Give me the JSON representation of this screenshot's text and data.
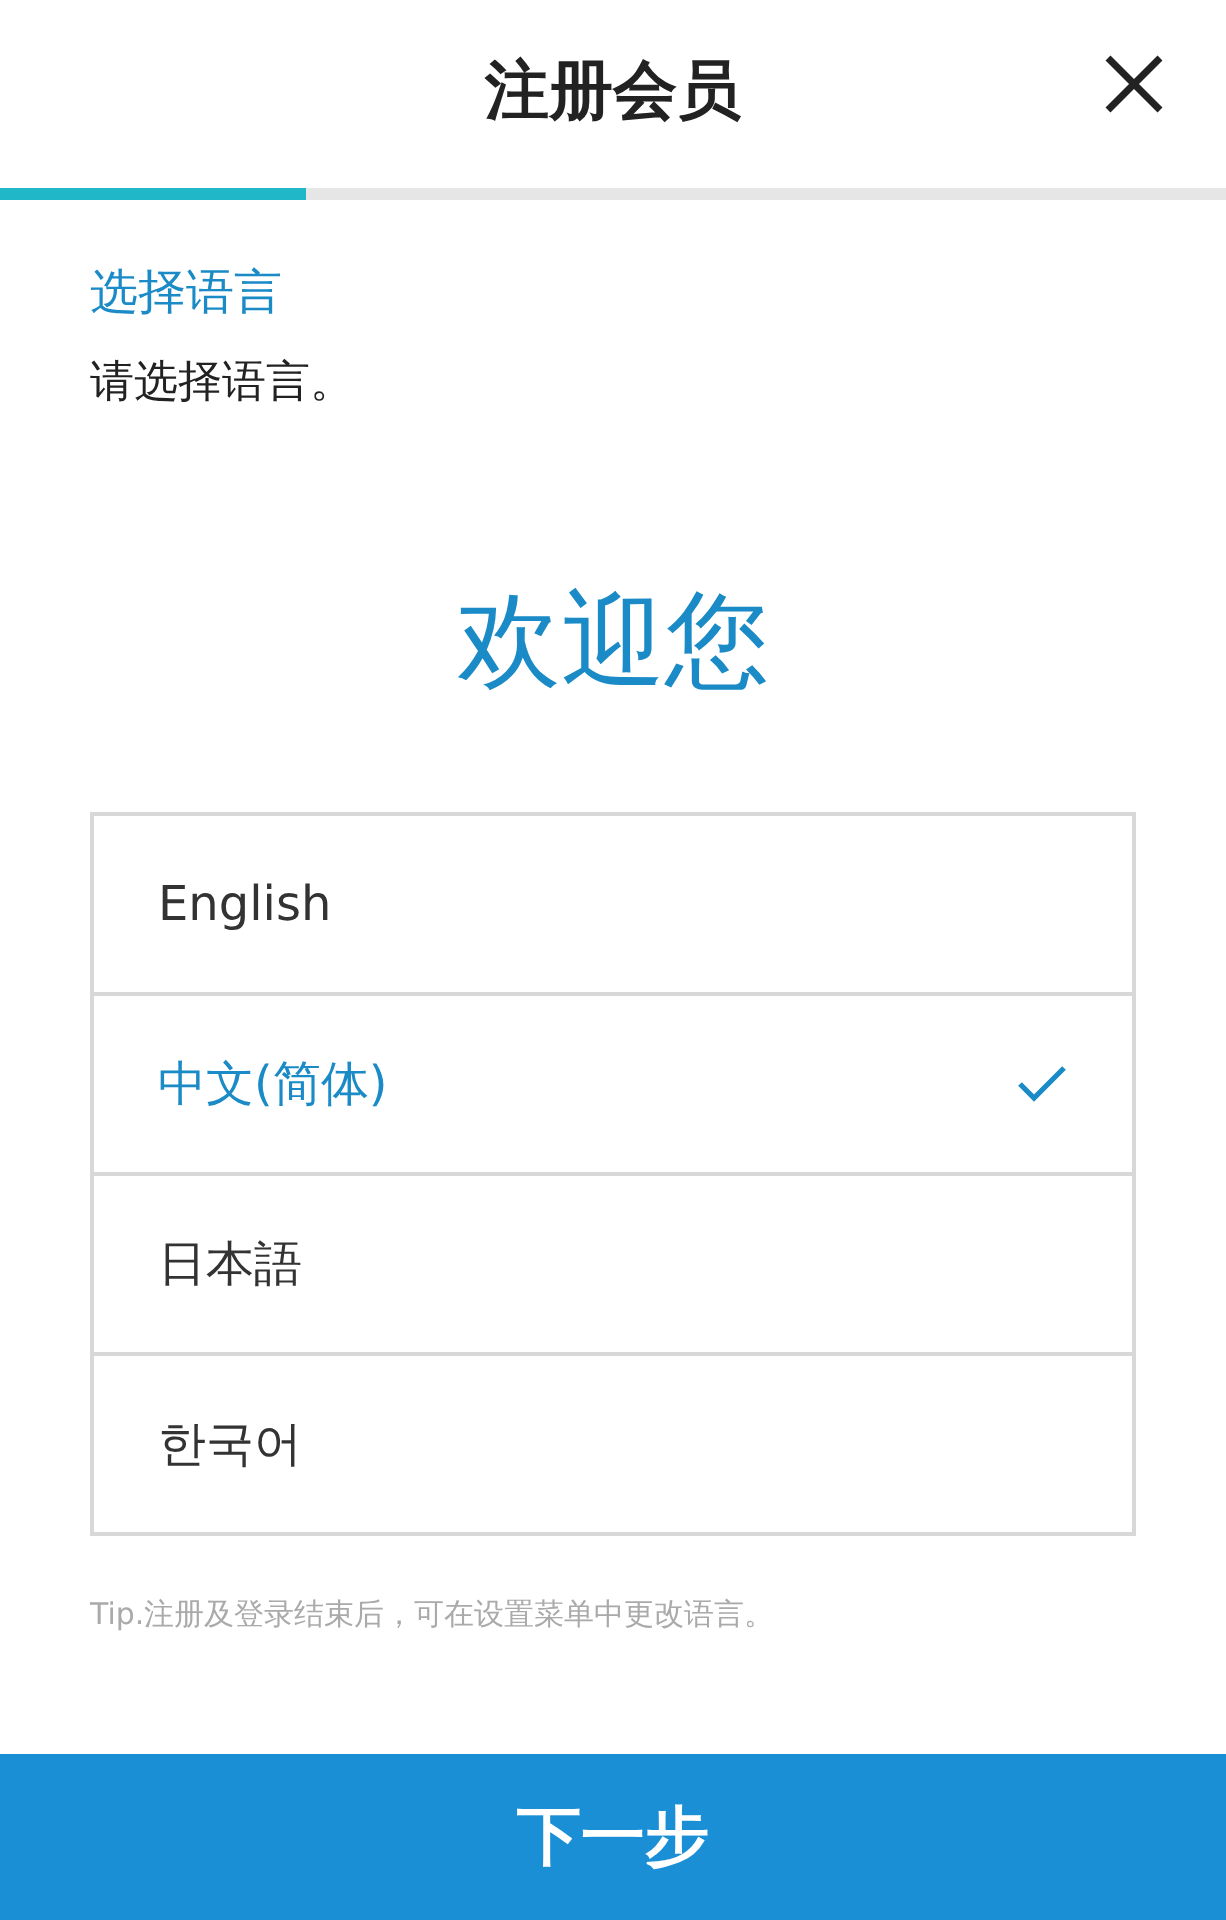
{
  "header": {
    "title": "注册会员"
  },
  "progress": {
    "level": 0.25
  },
  "section": {
    "title": "选择语言",
    "subtitle": "请选择语言。"
  },
  "welcome": "欢迎您",
  "languages": [
    {
      "label": "English",
      "selected": false
    },
    {
      "label": "中文(简体)",
      "selected": true
    },
    {
      "label": "日本語",
      "selected": false
    },
    {
      "label": "한국어",
      "selected": false
    }
  ],
  "tip": "Tip.注册及登录结束后，可在设置菜单中更改语言。",
  "next_button": "下一步"
}
